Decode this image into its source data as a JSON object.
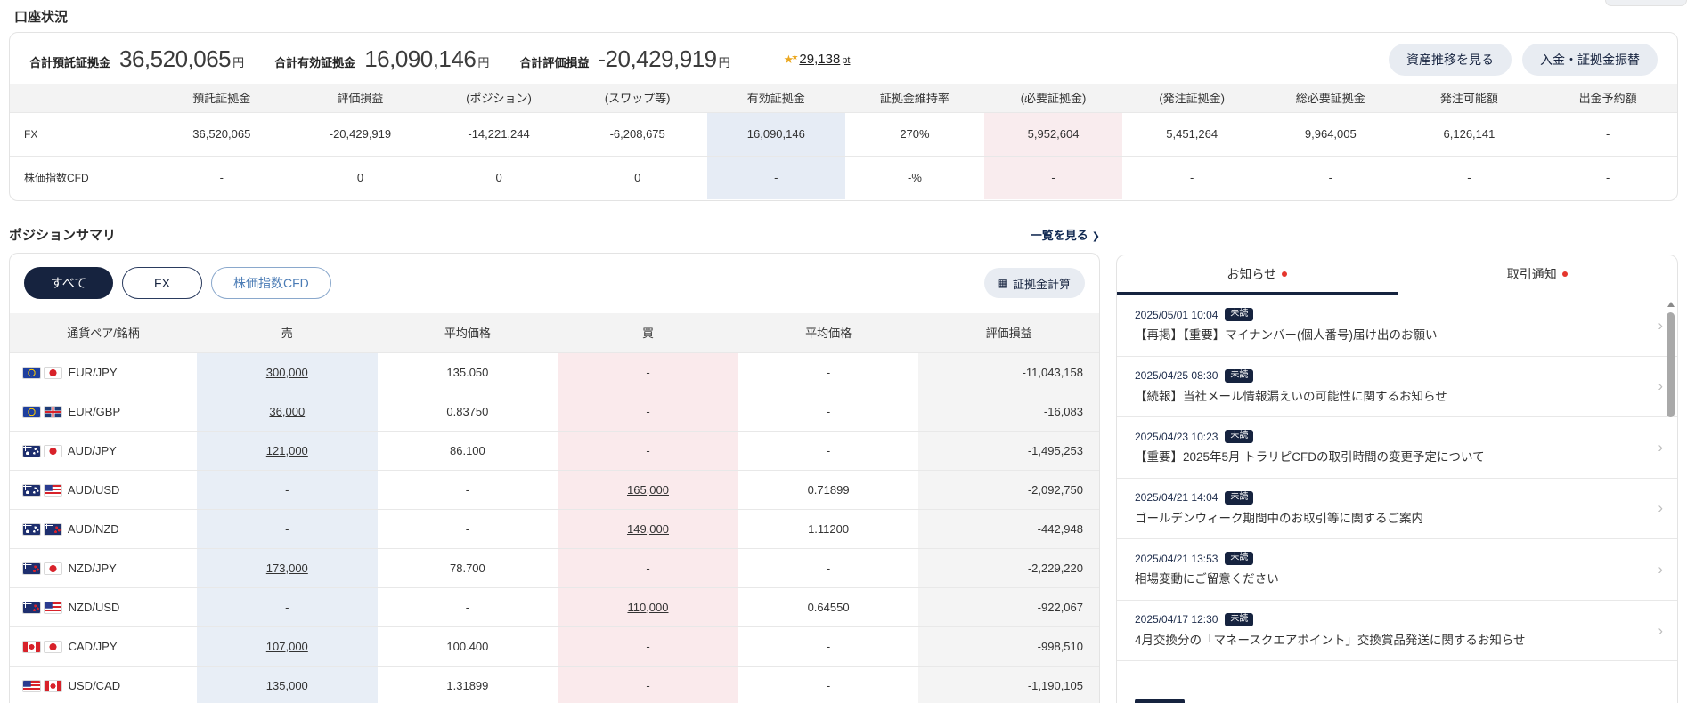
{
  "colors": {
    "navy": "#16233f",
    "sell_col_bg": "#e8eef6",
    "buy_col_bg": "#faeaec",
    "unread_dot_red": "#e5362d",
    "points_gold": "#eba821"
  },
  "icons": {
    "points_star": "★",
    "points_star_small": "★",
    "link_chevron": "❯",
    "item_chevron": "›",
    "calculator": "▦"
  },
  "header": {
    "account_title": "口座状況",
    "position_title": "ポジションサマリ",
    "view_list_link": "一覧を見る"
  },
  "account_summary": {
    "metrics": [
      {
        "label": "合計預託証拠金",
        "value": "36,520,065",
        "unit": "円"
      },
      {
        "label": "合計有効証拠金",
        "value": "16,090,146",
        "unit": "円"
      },
      {
        "label": "合計評価損益",
        "value": "-20,429,919",
        "unit": "円"
      }
    ],
    "points": {
      "value": "29,138",
      "unit": "pt"
    },
    "asset_button": "資産推移を見る",
    "deposit_button": "入金・証拠金振替"
  },
  "account_table": {
    "columns": [
      "預託証拠金",
      "評価損益",
      "(ポジション)",
      "(スワップ等)",
      "有効証拠金",
      "証拠金維持率",
      "(必要証拠金)",
      "(発注証拠金)",
      "総必要証拠金",
      "発注可能額",
      "出金予約額"
    ],
    "rows": [
      {
        "label": "FX",
        "values": [
          "36,520,065",
          "-20,429,919",
          "-14,221,244",
          "-6,208,675",
          "16,090,146",
          "270%",
          "5,952,604",
          "5,451,264",
          "9,964,005",
          "6,126,141",
          "-"
        ]
      },
      {
        "label": "株価指数CFD",
        "values": [
          "-",
          "0",
          "0",
          "0",
          "-",
          "-%",
          "-",
          "-",
          "-",
          "-",
          "-"
        ]
      }
    ]
  },
  "position_summary": {
    "tabs": [
      {
        "label": "すべて"
      },
      {
        "label": "FX"
      },
      {
        "label": "株価指数CFD"
      }
    ],
    "calc_button": "証拠金計算",
    "columns": [
      "通貨ペア/銘柄",
      "売",
      "平均価格",
      "買",
      "平均価格",
      "評価損益"
    ],
    "rows": [
      {
        "pair": "EUR/JPY",
        "flags": [
          "eu",
          "jp"
        ],
        "sell": "300,000",
        "sell_avg": "135.050",
        "buy": "-",
        "buy_avg": "-",
        "pl": "-11,043,158"
      },
      {
        "pair": "EUR/GBP",
        "flags": [
          "eu",
          "gb"
        ],
        "sell": "36,000",
        "sell_avg": "0.83750",
        "buy": "-",
        "buy_avg": "-",
        "pl": "-16,083"
      },
      {
        "pair": "AUD/JPY",
        "flags": [
          "au",
          "jp"
        ],
        "sell": "121,000",
        "sell_avg": "86.100",
        "buy": "-",
        "buy_avg": "-",
        "pl": "-1,495,253"
      },
      {
        "pair": "AUD/USD",
        "flags": [
          "au",
          "us"
        ],
        "sell": "-",
        "sell_avg": "-",
        "buy": "165,000",
        "buy_avg": "0.71899",
        "pl": "-2,092,750"
      },
      {
        "pair": "AUD/NZD",
        "flags": [
          "au",
          "nz"
        ],
        "sell": "-",
        "sell_avg": "-",
        "buy": "149,000",
        "buy_avg": "1.11200",
        "pl": "-442,948"
      },
      {
        "pair": "NZD/JPY",
        "flags": [
          "nz",
          "jp"
        ],
        "sell": "173,000",
        "sell_avg": "78.700",
        "buy": "-",
        "buy_avg": "-",
        "pl": "-2,229,220"
      },
      {
        "pair": "NZD/USD",
        "flags": [
          "nz",
          "us"
        ],
        "sell": "-",
        "sell_avg": "-",
        "buy": "110,000",
        "buy_avg": "0.64550",
        "pl": "-922,067"
      },
      {
        "pair": "CAD/JPY",
        "flags": [
          "ca",
          "jp"
        ],
        "sell": "107,000",
        "sell_avg": "100.400",
        "buy": "-",
        "buy_avg": "-",
        "pl": "-998,510"
      },
      {
        "pair": "USD/CAD",
        "flags": [
          "us",
          "ca"
        ],
        "sell": "135,000",
        "sell_avg": "1.31899",
        "buy": "-",
        "buy_avg": "-",
        "pl": "-1,190,105"
      }
    ]
  },
  "notifications": {
    "tabs": [
      {
        "label": "お知らせ"
      },
      {
        "label": "取引通知"
      }
    ],
    "unread_badge": "未読",
    "items": [
      {
        "datetime": "2025/05/01 10:04",
        "title": "【再掲】【重要】マイナンバー(個人番号)届け出のお願い"
      },
      {
        "datetime": "2025/04/25 08:30",
        "title": "【続報】当社メール情報漏えいの可能性に関するお知らせ"
      },
      {
        "datetime": "2025/04/23 10:23",
        "title": "【重要】2025年5月 トラリピCFDの取引時間の変更予定について"
      },
      {
        "datetime": "2025/04/21 14:04",
        "title": "ゴールデンウィーク期間中のお取引等に関するご案内"
      },
      {
        "datetime": "2025/04/21 13:53",
        "title": "相場変動にご留意ください"
      },
      {
        "datetime": "2025/04/17 12:30",
        "title": "4月交換分の「マネースクエアポイント」交換賞品発送に関するお知らせ"
      }
    ]
  }
}
